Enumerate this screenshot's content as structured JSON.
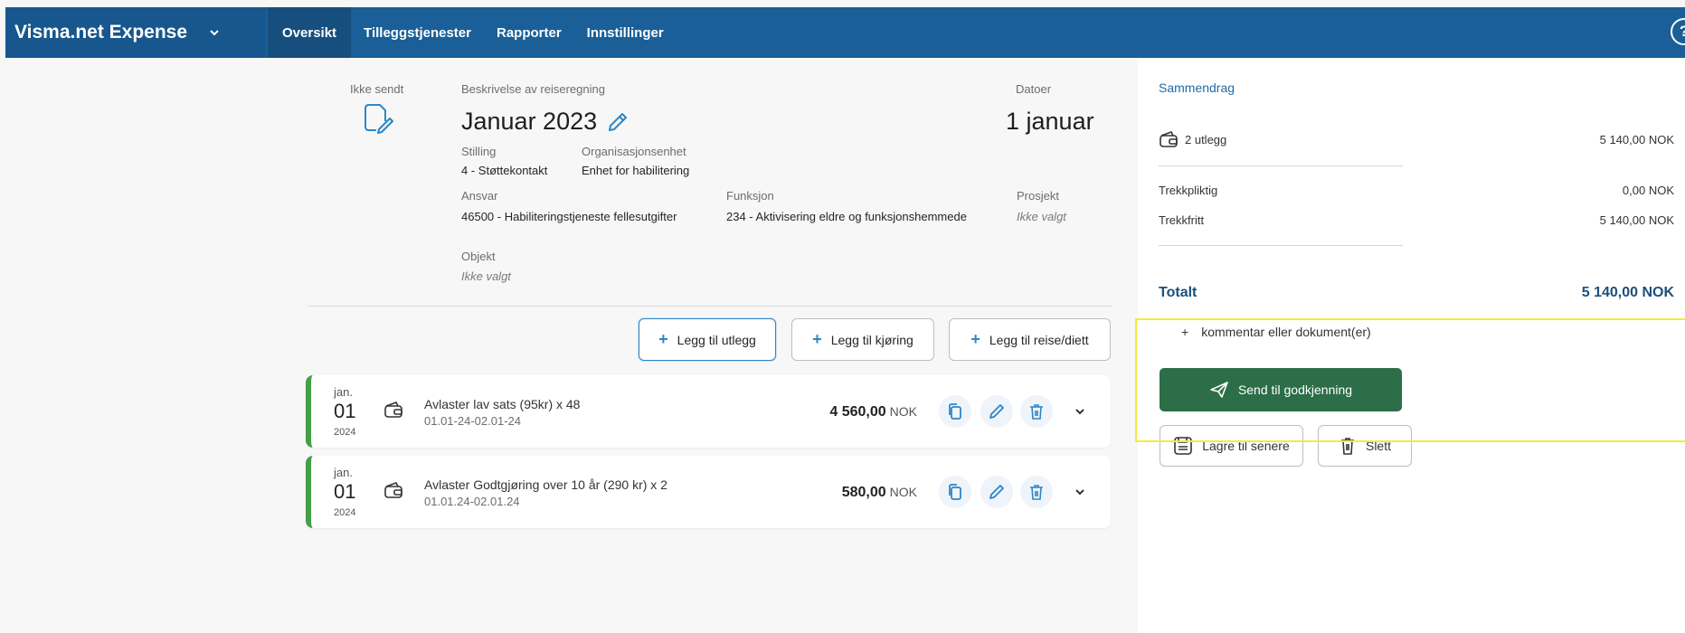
{
  "app": {
    "brand": "Visma.net Expense"
  },
  "nav": {
    "items": [
      "Oversikt",
      "Tilleggstjenester",
      "Rapporter",
      "Innstillinger"
    ],
    "help": "?"
  },
  "report": {
    "status_label": "Ikke sendt",
    "desc_label": "Beskrivelse av reiseregning",
    "title": "Januar 2023",
    "dates_label": "Datoer",
    "dates_value": "1 januar",
    "stilling_label": "Stilling",
    "stilling_value": "4 - Støttekontakt",
    "org_label": "Organisasjonsenhet",
    "org_value": "Enhet for habilitering",
    "ansvar_label": "Ansvar",
    "ansvar_value": "46500 - Habiliteringstjeneste fellesutgifter",
    "funksjon_label": "Funksjon",
    "funksjon_value": "234 - Aktivisering eldre og funksjonshemmede",
    "prosjekt_label": "Prosjekt",
    "prosjekt_value": "Ikke valgt",
    "objekt_label": "Objekt",
    "objekt_value": "Ikke valgt"
  },
  "actions": {
    "add_expense": "Legg til utlegg",
    "add_driving": "Legg til kjøring",
    "add_travel": "Legg til reise/diett"
  },
  "expenses": [
    {
      "month": "jan.",
      "day": "01",
      "year": "2024",
      "description": "Avlaster lav sats (95kr) x 48",
      "range": "01.01-24-02.01-24",
      "amount": "4 560,00",
      "currency": "NOK"
    },
    {
      "month": "jan.",
      "day": "01",
      "year": "2024",
      "description": "Avlaster Godtgjøring over 10 år (290 kr) x 2",
      "range": "01.01.24-02.01.24",
      "amount": "580,00",
      "currency": "NOK"
    }
  ],
  "summary": {
    "title": "Sammendrag",
    "count_label": "2 utlegg",
    "count_value": "5 140,00 NOK",
    "taxable_label": "Trekkpliktig",
    "taxable_value": "0,00 NOK",
    "taxfree_label": "Trekkfritt",
    "taxfree_value": "5 140,00 NOK",
    "total_label": "Totalt",
    "total_value": "5 140,00 NOK",
    "comment": "kommentar eller dokument(er)",
    "send": "Send til godkjenning",
    "save": "Lagre til senere",
    "delete": "Slett"
  },
  "colors": {
    "nav": "#1a5f97",
    "accent": "#2d86c5",
    "send": "#2c6e47",
    "row_border": "#43a047",
    "highlight": "#f4ea3c"
  }
}
